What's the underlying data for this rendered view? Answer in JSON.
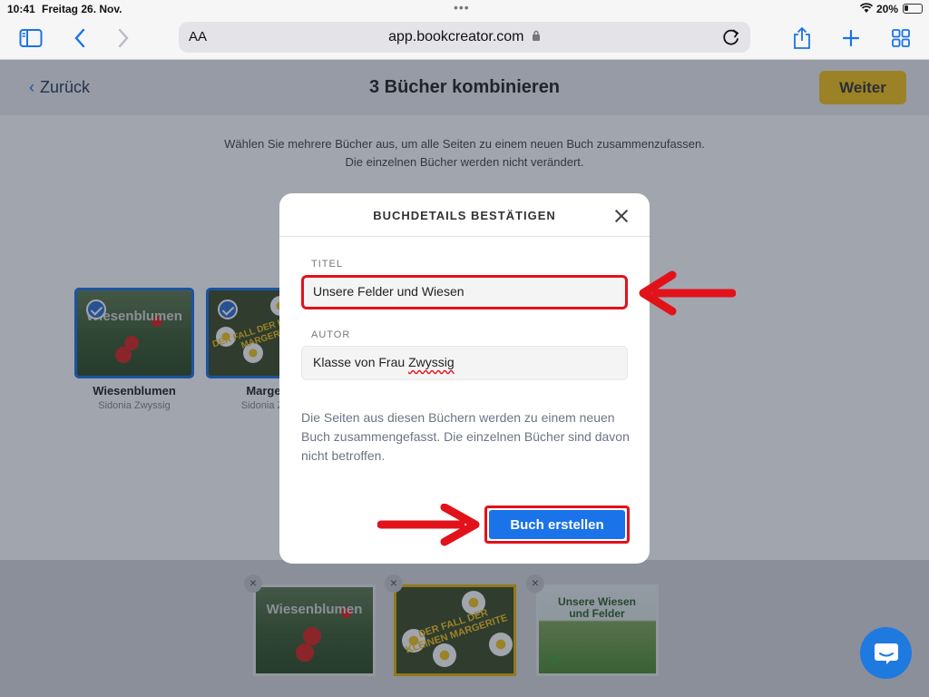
{
  "statusbar": {
    "time": "10:41",
    "date": "Freitag 26. Nov.",
    "battery": "20%"
  },
  "safari": {
    "aa_label": "AA",
    "url": "app.bookcreator.com"
  },
  "header": {
    "back_label": "Zurück",
    "title": "3 Bücher kombinieren",
    "next_label": "Weiter"
  },
  "instruction": {
    "line1": "Wählen Sie mehrere Bücher aus, um alle Seiten zu einem neuen Buch zusammenzufassen.",
    "line2": "Die einzelnen Bücher werden nicht verändert."
  },
  "books": [
    {
      "title": "Wiesenblumen",
      "author": "Sidonia Zwyssig",
      "cover_text": "Wiesenblumen"
    },
    {
      "title": "Marger",
      "author": "Sidonia Zw",
      "cover_text": "DER FALL DER KLEINEN MARGERITE"
    }
  ],
  "tray": {
    "items": [
      {
        "cover_text": "Wiesenblumen"
      },
      {
        "cover_text": "DER FALL DER KLEINEN MARGERITE"
      },
      {
        "cover_text": "Unsere Wiesen und Felder"
      }
    ],
    "remove_symbol": "×"
  },
  "modal": {
    "title": "BUCHDETAILS BESTÄTIGEN",
    "title_label": "TITEL",
    "title_value": "Unsere Felder und Wiesen",
    "author_label": "AUTOR",
    "author_value_prefix": "Klasse von Frau ",
    "author_value_name": "Zwyssig",
    "description": "Die Seiten aus diesen Büchern werden zu einem neuen Buch zusammengefasst. Die einzelnen Bücher sind davon nicht betroffen.",
    "create_label": "Buch erstellen"
  },
  "colors": {
    "accent": "#1a73e8",
    "next_button": "#f7c318",
    "highlight": "#e2121b"
  },
  "icons": [
    "sidebar-icon",
    "back-chevron-icon",
    "forward-chevron-icon",
    "lock-icon",
    "reload-icon",
    "share-icon",
    "plus-icon",
    "tabs-grid-icon",
    "check-icon",
    "close-icon",
    "chat-icon",
    "arrow-icon"
  ]
}
